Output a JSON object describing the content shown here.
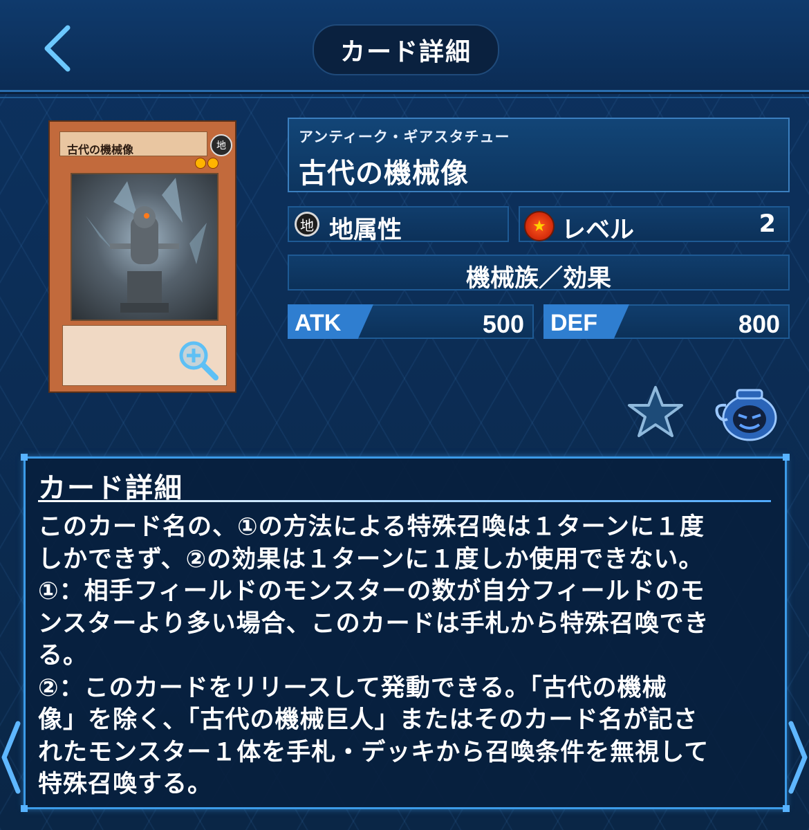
{
  "header": {
    "title": "カード詳細",
    "back_icon": "chevron-left-icon"
  },
  "card": {
    "image_name": "古代の機械像",
    "image_attribute": "地",
    "ruby": "アンティーク・ギアスタチュー",
    "name": "古代の機械像",
    "attribute_icon_text": "地",
    "attribute_label": "地属性",
    "level_label": "レベル",
    "level_value": "2",
    "type_line": "機械族／効果",
    "atk_label": "ATK",
    "atk_value": "500",
    "def_label": "DEF",
    "def_value": "800"
  },
  "detail": {
    "title": "カード詳細",
    "lines": [
      "このカード名の、①の方法による特殊召喚は１ターンに１度",
      "しかできず、②の効果は１ターンに１度しか使用できない。",
      "①：相手フィールドのモンスターの数が自分フィールドのモ",
      "ンスターより多い場合、このカードは手札から特殊召喚でき",
      "る。",
      "②：このカードをリリースして発動できる。「古代の機械",
      "像」を除く、「古代の機械巨人」またはそのカード名が記さ",
      "れたモンスター１体を手札・デッキから召喚条件を無視して",
      "特殊召喚する。"
    ]
  },
  "colors": {
    "accent": "#3c9be8",
    "background": "#0b2a4e",
    "atk_tag": "#2f7ed0"
  }
}
